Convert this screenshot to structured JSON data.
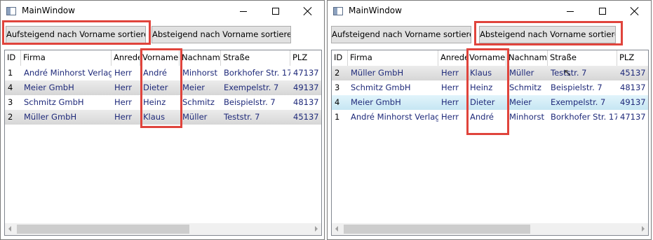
{
  "window_title": "MainWindow",
  "buttons": {
    "asc": "Aufsteigend nach Vorname sortieren",
    "desc": "Absteigend nach Vorname sortieren"
  },
  "columns": [
    "ID",
    "Firma",
    "Anrede",
    "Vorname",
    "Nachname",
    "Straße",
    "PLZ"
  ],
  "left_rows": [
    [
      "1",
      "André Minhorst Verlag",
      "Herr",
      "André",
      "Minhorst",
      "Borkhofer Str. 17",
      "47137"
    ],
    [
      "4",
      "Meier GmbH",
      "Herr",
      "Dieter",
      "Meier",
      "Exempelstr. 7",
      "49137"
    ],
    [
      "3",
      "Schmitz GmbH",
      "Herr",
      "Heinz",
      "Schmitz",
      "Beispielstr. 7",
      "48137"
    ],
    [
      "2",
      "Müller GmbH",
      "Herr",
      "Klaus",
      "Müller",
      "Teststr. 7",
      "45137"
    ]
  ],
  "right_rows": [
    [
      "2",
      "Müller GmbH",
      "Herr",
      "Klaus",
      "Müller",
      "Teststr. 7",
      "45137"
    ],
    [
      "3",
      "Schmitz GmbH",
      "Herr",
      "Heinz",
      "Schmitz",
      "Beispielstr. 7",
      "48137"
    ],
    [
      "4",
      "Meier GmbH",
      "Herr",
      "Dieter",
      "Meier",
      "Exempelstr. 7",
      "49137"
    ],
    [
      "1",
      "André Minhorst Verlag",
      "Herr",
      "André",
      "Minhorst",
      "Borkhofer Str. 17",
      "47137"
    ]
  ],
  "left_row_styles": [
    "plain",
    "alt",
    "plain",
    "alt"
  ],
  "right_row_styles": [
    "alt",
    "plain",
    "selected",
    "plain"
  ],
  "colors": {
    "highlight": "#e0443c",
    "cell_text": "#1f2a7a",
    "selected_row": "#c6e6f3"
  },
  "icons": [
    "window-app-icon",
    "minimize-icon",
    "maximize-icon",
    "close-icon",
    "scroll-left-arrow",
    "scroll-right-arrow",
    "mouse-cursor-icon"
  ]
}
